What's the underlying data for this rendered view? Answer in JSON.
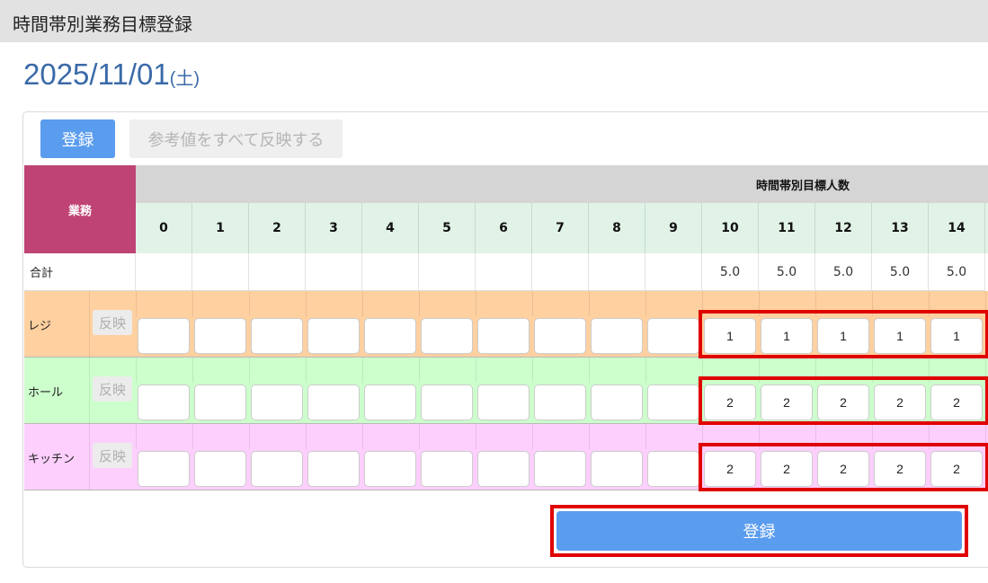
{
  "header": {
    "title": "時間帯別業務目標登録"
  },
  "date": {
    "value": "2025/11/01",
    "dow": "(土)"
  },
  "toolbar": {
    "register_label": "登録",
    "reflect_all_label": "参考値をすべて反映する"
  },
  "table": {
    "gyomu_header": "業務",
    "group_header": "時間帯別目標人数",
    "hours": [
      "0",
      "1",
      "2",
      "3",
      "4",
      "5",
      "6",
      "7",
      "8",
      "9",
      "10",
      "11",
      "12",
      "13",
      "14"
    ],
    "total_label": "合計",
    "totals": [
      "",
      "",
      "",
      "",
      "",
      "",
      "",
      "",
      "",
      "",
      "5.0",
      "5.0",
      "5.0",
      "5.0",
      "5.0"
    ],
    "reflect_label": "反映",
    "rows": [
      {
        "name": "レジ",
        "color": "#ffd0a0",
        "values": [
          "",
          "",
          "",
          "",
          "",
          "",
          "",
          "",
          "",
          "",
          "1",
          "1",
          "1",
          "1",
          "1"
        ]
      },
      {
        "name": "ホール",
        "color": "#ccffcc",
        "values": [
          "",
          "",
          "",
          "",
          "",
          "",
          "",
          "",
          "",
          "",
          "2",
          "2",
          "2",
          "2",
          "2"
        ]
      },
      {
        "name": "キッチン",
        "color": "#fccffc",
        "values": [
          "",
          "",
          "",
          "",
          "",
          "",
          "",
          "",
          "",
          "",
          "2",
          "2",
          "2",
          "2",
          "2"
        ]
      }
    ]
  },
  "footer": {
    "register_label": "登録"
  },
  "colors": {
    "accent": "#5a9cee",
    "highlight": "#e00000",
    "gyomu": "#bf4374"
  }
}
